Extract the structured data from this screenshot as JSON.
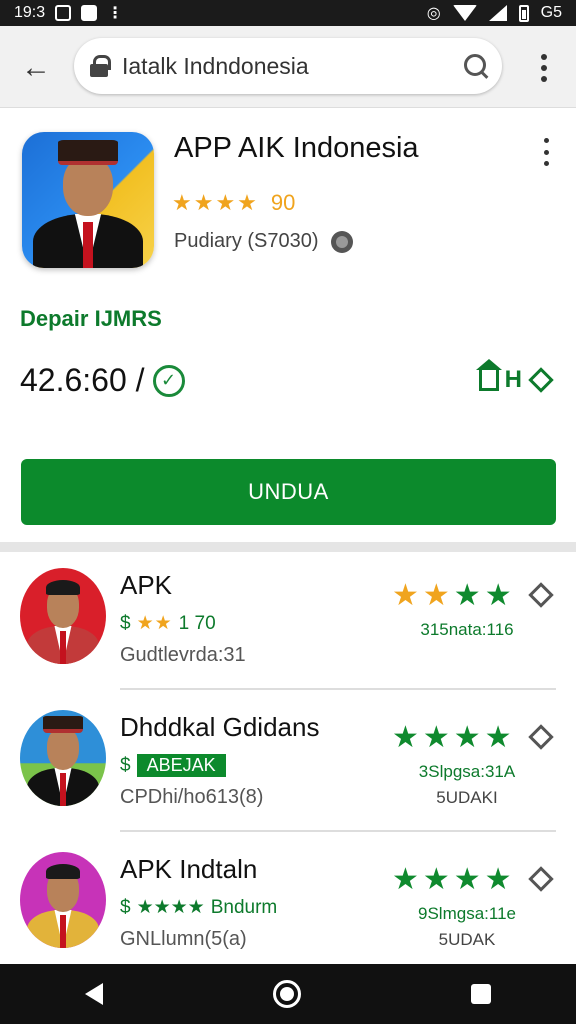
{
  "status_bar": {
    "time": "19:3",
    "network": "G5",
    "icons": [
      "notification-icon",
      "app-notification-icon",
      "more-dots-icon",
      "alarm-icon",
      "wifi-icon",
      "signal-icon",
      "battery-icon"
    ]
  },
  "browser": {
    "url": "Iatalk Indndonesia",
    "icons": [
      "back-arrow-icon",
      "lock-icon",
      "search-icon",
      "overflow-menu-icon"
    ]
  },
  "app": {
    "title": "APP AIK Indonesia",
    "stars": "★★★★",
    "rating_value": "90",
    "meta": "Pudiary (S7030)",
    "developer_label": "Depair IJMRS",
    "price": "42.6:60 /",
    "share_text": "H",
    "install_label": "UNDUA",
    "colors": {
      "accent_green": "#0c8a2c",
      "star_gold": "#f0a41e",
      "icon_blue": "#1c6fd6",
      "icon_yellow": "#f2c023"
    }
  },
  "list": [
    {
      "title": "APK",
      "sub_prefix": "$",
      "sub_stars": "★★",
      "sub_text": "1 70",
      "meta": "Gudtlevrda:31",
      "stars_gold": "★★",
      "stars_green": "★★",
      "count": "315nata:116",
      "extra": "",
      "bg": "#d91f2a"
    },
    {
      "title": "Dhddkal Gdidans",
      "sub_prefix": "$",
      "badge": "ABEJAK",
      "meta": "CPDhi/ho613(8)",
      "stars_gold": "",
      "stars_green": "★★★★",
      "count": "3Slpgsa:31A",
      "extra": "5UDAKI",
      "bg": "#2e8fd8"
    },
    {
      "title": "APK Indtaln",
      "sub_prefix": "$",
      "sub_stars_green": "★★★★",
      "sub_text": "Bndurm",
      "meta": "GNLlumn(5(a)",
      "stars_gold": "",
      "stars_green": "★★★★",
      "count": "9Slmgsa:11e",
      "extra": "5UDAK",
      "bg": "#c733b8"
    }
  ]
}
